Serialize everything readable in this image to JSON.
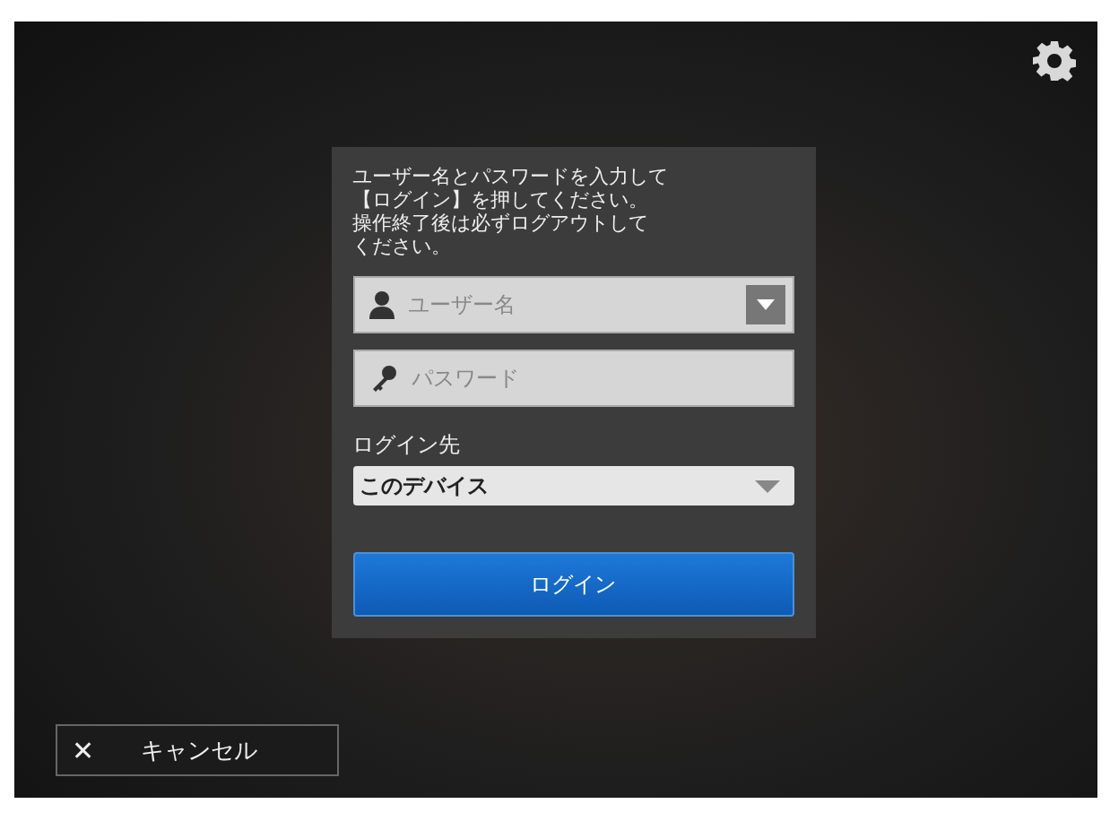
{
  "instructions": [
    "ユーザー名とパスワードを入力して",
    "【ログイン】を押してください。",
    "操作終了後は必ずログアウトして",
    "ください。"
  ],
  "username": {
    "placeholder": "ユーザー名"
  },
  "password": {
    "placeholder": "パスワード"
  },
  "destination": {
    "label": "ログイン先",
    "value": "このデバイス"
  },
  "login_button": "ログイン",
  "cancel_button": {
    "icon": "✕",
    "label": "キャンセル"
  }
}
